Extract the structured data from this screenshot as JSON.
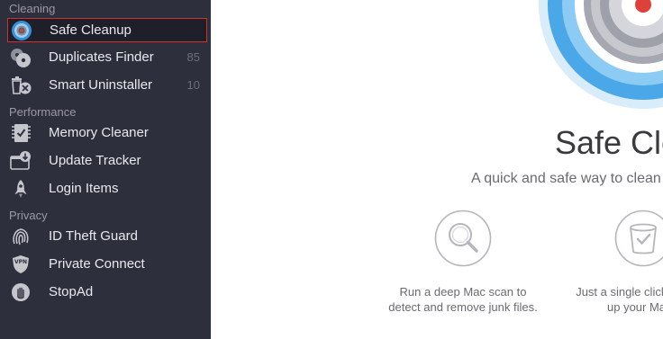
{
  "sidebar": {
    "sections": {
      "cleaning": "Cleaning",
      "performance": "Performance",
      "privacy": "Privacy"
    },
    "items": [
      {
        "label": "Safe Cleanup",
        "icon": "safe-cleanup-icon",
        "count": ""
      },
      {
        "label": "Duplicates Finder",
        "icon": "duplicates-finder-icon",
        "count": "85"
      },
      {
        "label": "Smart Uninstaller",
        "icon": "smart-uninstaller-icon",
        "count": "10"
      },
      {
        "label": "Memory Cleaner",
        "icon": "memory-cleaner-icon",
        "count": ""
      },
      {
        "label": "Update Tracker",
        "icon": "update-tracker-icon",
        "count": ""
      },
      {
        "label": "Login Items",
        "icon": "login-items-icon",
        "count": ""
      },
      {
        "label": "ID Theft Guard",
        "icon": "id-theft-guard-icon",
        "count": ""
      },
      {
        "label": "Private Connect",
        "icon": "private-connect-icon",
        "count": ""
      },
      {
        "label": "StopAd",
        "icon": "stopad-icon",
        "count": ""
      }
    ],
    "selected_index": 0
  },
  "main": {
    "title": "Safe Cle",
    "subtitle": "A quick and safe way to clean",
    "features": [
      {
        "icon": "magnifier-icon",
        "line1": "Run a deep Mac scan to",
        "line2": "detect and remove junk files."
      },
      {
        "icon": "trash-check-icon",
        "line1": "Just a single click",
        "line2": "up your Mac"
      }
    ]
  },
  "colors": {
    "sidebar_bg": "#2e2f3d",
    "selected_border": "#d0312d",
    "hero_blue": "#4aa8e8",
    "hero_red": "#e0403a"
  }
}
